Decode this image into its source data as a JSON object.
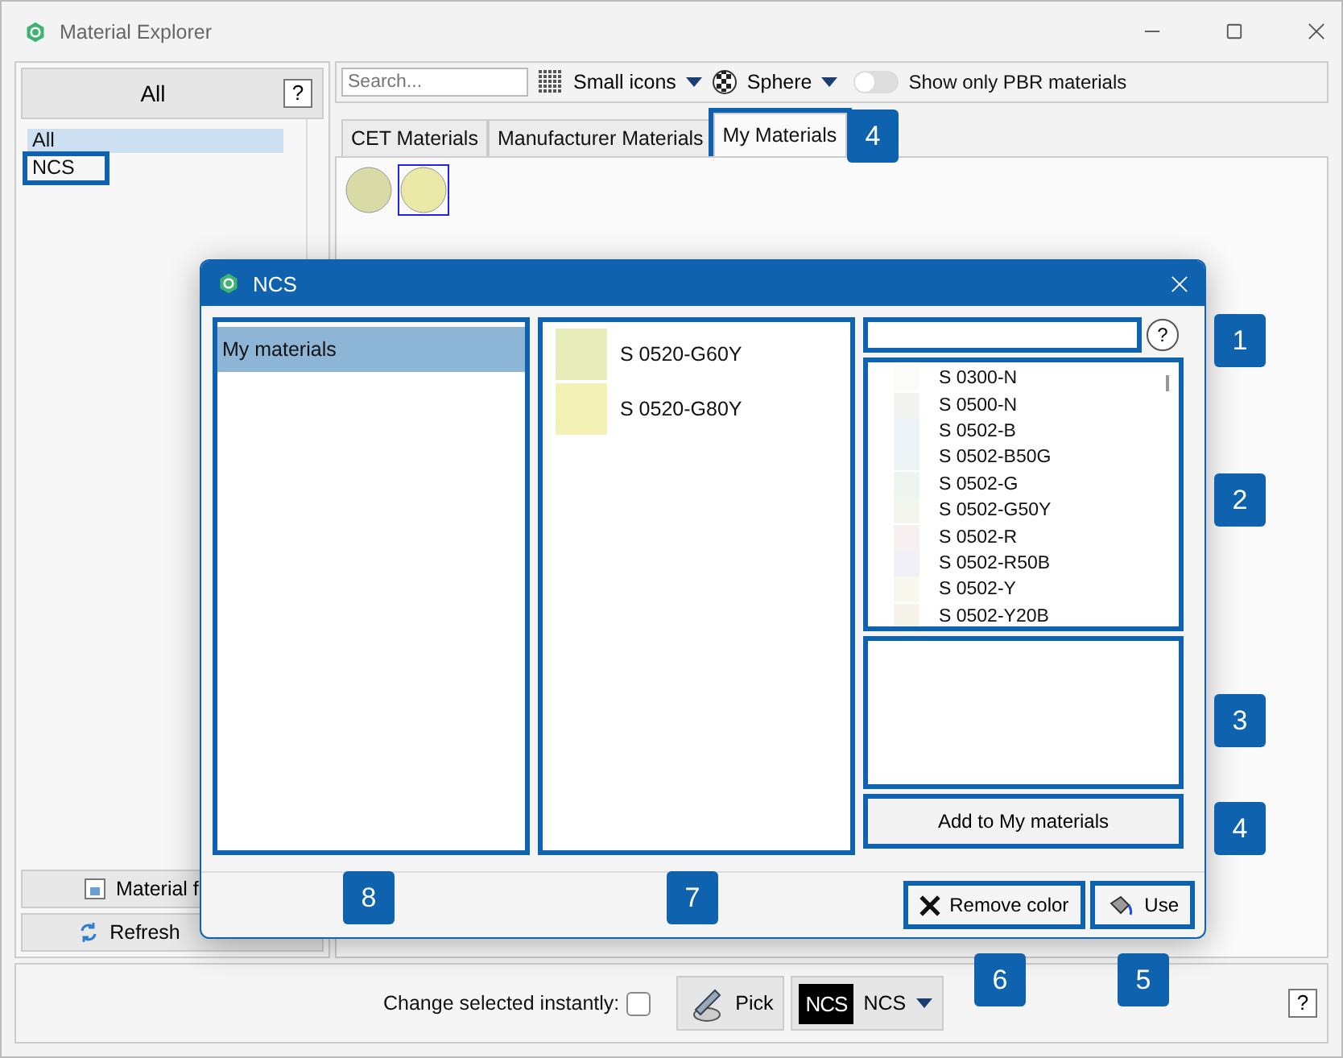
{
  "window": {
    "title": "Material Explorer"
  },
  "sidebar": {
    "filter_button": "All",
    "help": "?",
    "items": [
      {
        "label": "All",
        "selected": true,
        "highlighted": false
      },
      {
        "label": "NCS",
        "selected": false,
        "highlighted": true
      }
    ],
    "buttons": [
      {
        "label": "Material f",
        "kind": "file"
      },
      {
        "label": "Refresh",
        "kind": "refresh"
      }
    ]
  },
  "toolbar": {
    "search": {
      "placeholder": "Search..."
    },
    "view": "Small icons",
    "shape": "Sphere",
    "pbr_toggle": {
      "on": false,
      "label": "Show only PBR materials"
    }
  },
  "tabs": [
    {
      "label": "CET Materials",
      "selected": false,
      "highlighted": false
    },
    {
      "label": "Manufacturer Materials",
      "selected": false,
      "highlighted": false
    },
    {
      "label": "My Materials",
      "selected": true,
      "highlighted": true
    }
  ],
  "thumbnails": [
    {
      "color": "#d8dba6",
      "selected": false
    },
    {
      "color": "#e9e8a6",
      "selected": true
    }
  ],
  "bottom_bar": {
    "instant_label": "Change selected instantly:",
    "instant_checked": false,
    "pick": "Pick",
    "logo": "NCS",
    "system": "NCS",
    "help": "?"
  },
  "dialog": {
    "title": "NCS",
    "groups": [
      {
        "label": "My materials",
        "selected": true
      }
    ],
    "my_colors": [
      {
        "name": "S 0520-G60Y",
        "color": "#e6edbb"
      },
      {
        "name": "S 0520-G80Y",
        "color": "#f2f2b6"
      }
    ],
    "help": "?",
    "ncs_list": [
      {
        "name": "S 0300-N",
        "color": "#fbfbfa"
      },
      {
        "name": "S 0500-N",
        "color": "#f3f3f1"
      },
      {
        "name": "S 0502-B",
        "color": "#eef3f8"
      },
      {
        "name": "S 0502-B50G",
        "color": "#eef4f5"
      },
      {
        "name": "S 0502-G",
        "color": "#eff4f1"
      },
      {
        "name": "S 0502-G50Y",
        "color": "#f3f6ee"
      },
      {
        "name": "S 0502-R",
        "color": "#f7f0f0"
      },
      {
        "name": "S 0502-R50B",
        "color": "#f1f0f6"
      },
      {
        "name": "S 0502-Y",
        "color": "#f8f8ee"
      },
      {
        "name": "S 0502-Y20B",
        "color": "#f6f4ea"
      }
    ],
    "add_button": "Add to My materials",
    "remove_button": "Remove color",
    "use_button": "Use"
  },
  "callouts": [
    "1",
    "2",
    "3",
    "4",
    "4",
    "5",
    "6",
    "7",
    "8"
  ]
}
